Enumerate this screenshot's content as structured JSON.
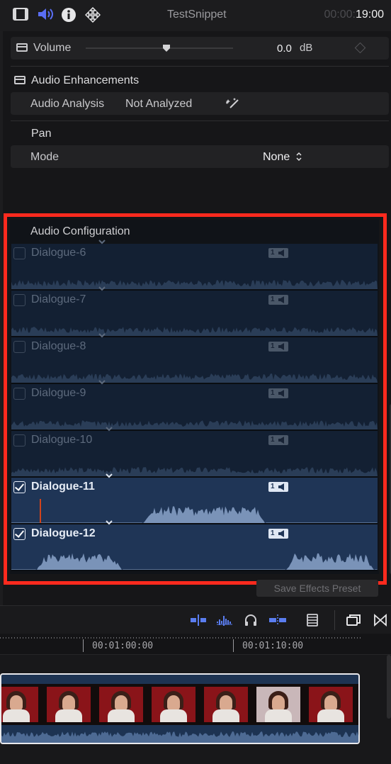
{
  "toolbar": {
    "title": "TestSnippet",
    "timecode_dim": "00:00:",
    "timecode_main": "19:00"
  },
  "volume": {
    "label": "Volume",
    "value": "0.0",
    "unit": "dB",
    "slider_level": 0.55
  },
  "enhancements": {
    "header": "Audio Enhancements",
    "analysis_label": "Audio Analysis",
    "analysis_value": "Not Analyzed"
  },
  "pan": {
    "header": "Pan",
    "mode_label": "Mode",
    "mode_value": "None"
  },
  "audio_config": {
    "title": "Audio Configuration",
    "channels": [
      {
        "name": "Dialogue-6",
        "enabled": false,
        "badge": "1"
      },
      {
        "name": "Dialogue-7",
        "enabled": false,
        "badge": "1"
      },
      {
        "name": "Dialogue-8",
        "enabled": false,
        "badge": "1"
      },
      {
        "name": "Dialogue-9",
        "enabled": false,
        "badge": "1"
      },
      {
        "name": "Dialogue-10",
        "enabled": false,
        "badge": "1"
      },
      {
        "name": "Dialogue-11",
        "enabled": true,
        "badge": "1"
      },
      {
        "name": "Dialogue-12",
        "enabled": true,
        "badge": "1"
      }
    ]
  },
  "save_preset": "Save Effects Preset",
  "timeline": {
    "ruler": [
      "00:01:00:00",
      "00:01:10:00"
    ]
  },
  "colors": {
    "highlight": "#ff2a1e",
    "accent": "#5a7df0",
    "selected_row": "#1f3556"
  },
  "icons": [
    "film-icon",
    "speaker-icon",
    "info-icon",
    "transform-icon",
    "analysis-wand-icon",
    "stepper-icon",
    "chevron-down-icon",
    "headphones-icon",
    "waveform-icon"
  ]
}
